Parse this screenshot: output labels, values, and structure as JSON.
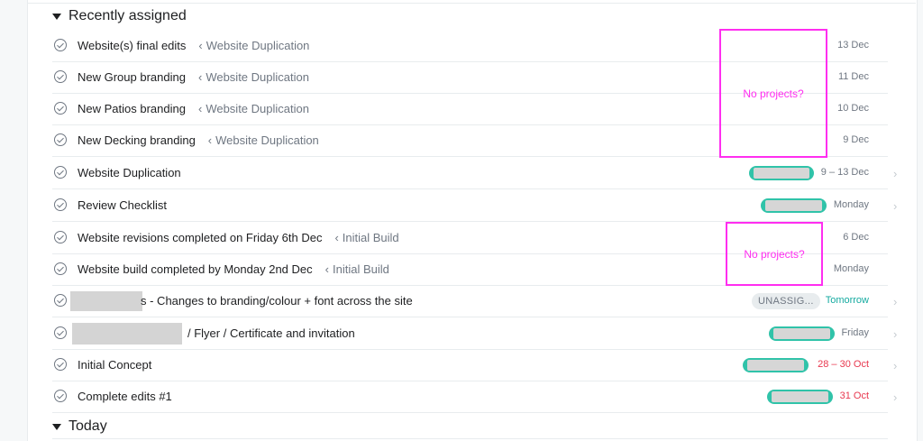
{
  "sections": {
    "recent": "Recently assigned",
    "today": "Today"
  },
  "tasks": [
    {
      "name": "Website(s) final edits",
      "parent": "Website Duplication",
      "date": "13 Dec"
    },
    {
      "name": "New Group branding",
      "parent": "Website Duplication",
      "date": "11 Dec"
    },
    {
      "name": "New Patios branding",
      "parent": "Website Duplication",
      "date": "10 Dec"
    },
    {
      "name": "New Decking branding",
      "parent": "Website Duplication",
      "date": "9 Dec"
    },
    {
      "name": "Website Duplication",
      "date": "9 – 13 Dec"
    },
    {
      "name": "Review Checklist",
      "date": "Monday"
    },
    {
      "name": "Website revisions completed on Friday 6th Dec",
      "parent": "Initial Build",
      "date": "6 Dec"
    },
    {
      "name": "Website build completed by Monday 2nd Dec",
      "parent": "Initial Build",
      "date": "Monday"
    },
    {
      "name": "s - Changes to branding/colour + font across the site",
      "badge": "UNASSIG...",
      "date": "Tomorrow"
    },
    {
      "name": "/ Flyer / Certificate and invitation",
      "date": "Friday"
    },
    {
      "name": "Initial Concept",
      "date": "28 – 30 Oct"
    },
    {
      "name": "Complete edits #1",
      "date": "31 Oct"
    }
  ],
  "parent_arrow": "‹",
  "annotations": {
    "no_projects_1": "No projects?",
    "no_projects_2": "No projects?"
  },
  "colors": {
    "accent": "#30c3a9",
    "due_soon": "#14aaa0",
    "overdue": "#e8384f",
    "annotation": "#ff2ef0"
  },
  "icons": {
    "check": "check-circle-icon",
    "caret": "caret-down-icon",
    "chevron": "chevron-right-icon"
  }
}
